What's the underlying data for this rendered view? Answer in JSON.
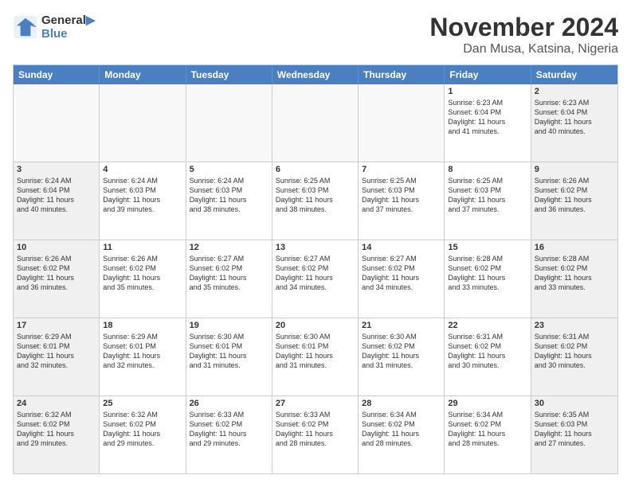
{
  "header": {
    "logo_line1": "General",
    "logo_line2": "Blue",
    "month_title": "November 2024",
    "location": "Dan Musa, Katsina, Nigeria"
  },
  "days_of_week": [
    "Sunday",
    "Monday",
    "Tuesday",
    "Wednesday",
    "Thursday",
    "Friday",
    "Saturday"
  ],
  "weeks": [
    [
      {
        "day": "",
        "info": ""
      },
      {
        "day": "",
        "info": ""
      },
      {
        "day": "",
        "info": ""
      },
      {
        "day": "",
        "info": ""
      },
      {
        "day": "",
        "info": ""
      },
      {
        "day": "1",
        "info": "Sunrise: 6:23 AM\nSunset: 6:04 PM\nDaylight: 11 hours\nand 41 minutes."
      },
      {
        "day": "2",
        "info": "Sunrise: 6:23 AM\nSunset: 6:04 PM\nDaylight: 11 hours\nand 40 minutes."
      }
    ],
    [
      {
        "day": "3",
        "info": "Sunrise: 6:24 AM\nSunset: 6:04 PM\nDaylight: 11 hours\nand 40 minutes."
      },
      {
        "day": "4",
        "info": "Sunrise: 6:24 AM\nSunset: 6:03 PM\nDaylight: 11 hours\nand 39 minutes."
      },
      {
        "day": "5",
        "info": "Sunrise: 6:24 AM\nSunset: 6:03 PM\nDaylight: 11 hours\nand 38 minutes."
      },
      {
        "day": "6",
        "info": "Sunrise: 6:25 AM\nSunset: 6:03 PM\nDaylight: 11 hours\nand 38 minutes."
      },
      {
        "day": "7",
        "info": "Sunrise: 6:25 AM\nSunset: 6:03 PM\nDaylight: 11 hours\nand 37 minutes."
      },
      {
        "day": "8",
        "info": "Sunrise: 6:25 AM\nSunset: 6:03 PM\nDaylight: 11 hours\nand 37 minutes."
      },
      {
        "day": "9",
        "info": "Sunrise: 6:26 AM\nSunset: 6:02 PM\nDaylight: 11 hours\nand 36 minutes."
      }
    ],
    [
      {
        "day": "10",
        "info": "Sunrise: 6:26 AM\nSunset: 6:02 PM\nDaylight: 11 hours\nand 36 minutes."
      },
      {
        "day": "11",
        "info": "Sunrise: 6:26 AM\nSunset: 6:02 PM\nDaylight: 11 hours\nand 35 minutes."
      },
      {
        "day": "12",
        "info": "Sunrise: 6:27 AM\nSunset: 6:02 PM\nDaylight: 11 hours\nand 35 minutes."
      },
      {
        "day": "13",
        "info": "Sunrise: 6:27 AM\nSunset: 6:02 PM\nDaylight: 11 hours\nand 34 minutes."
      },
      {
        "day": "14",
        "info": "Sunrise: 6:27 AM\nSunset: 6:02 PM\nDaylight: 11 hours\nand 34 minutes."
      },
      {
        "day": "15",
        "info": "Sunrise: 6:28 AM\nSunset: 6:02 PM\nDaylight: 11 hours\nand 33 minutes."
      },
      {
        "day": "16",
        "info": "Sunrise: 6:28 AM\nSunset: 6:02 PM\nDaylight: 11 hours\nand 33 minutes."
      }
    ],
    [
      {
        "day": "17",
        "info": "Sunrise: 6:29 AM\nSunset: 6:01 PM\nDaylight: 11 hours\nand 32 minutes."
      },
      {
        "day": "18",
        "info": "Sunrise: 6:29 AM\nSunset: 6:01 PM\nDaylight: 11 hours\nand 32 minutes."
      },
      {
        "day": "19",
        "info": "Sunrise: 6:30 AM\nSunset: 6:01 PM\nDaylight: 11 hours\nand 31 minutes."
      },
      {
        "day": "20",
        "info": "Sunrise: 6:30 AM\nSunset: 6:01 PM\nDaylight: 11 hours\nand 31 minutes."
      },
      {
        "day": "21",
        "info": "Sunrise: 6:30 AM\nSunset: 6:02 PM\nDaylight: 11 hours\nand 31 minutes."
      },
      {
        "day": "22",
        "info": "Sunrise: 6:31 AM\nSunset: 6:02 PM\nDaylight: 11 hours\nand 30 minutes."
      },
      {
        "day": "23",
        "info": "Sunrise: 6:31 AM\nSunset: 6:02 PM\nDaylight: 11 hours\nand 30 minutes."
      }
    ],
    [
      {
        "day": "24",
        "info": "Sunrise: 6:32 AM\nSunset: 6:02 PM\nDaylight: 11 hours\nand 29 minutes."
      },
      {
        "day": "25",
        "info": "Sunrise: 6:32 AM\nSunset: 6:02 PM\nDaylight: 11 hours\nand 29 minutes."
      },
      {
        "day": "26",
        "info": "Sunrise: 6:33 AM\nSunset: 6:02 PM\nDaylight: 11 hours\nand 29 minutes."
      },
      {
        "day": "27",
        "info": "Sunrise: 6:33 AM\nSunset: 6:02 PM\nDaylight: 11 hours\nand 28 minutes."
      },
      {
        "day": "28",
        "info": "Sunrise: 6:34 AM\nSunset: 6:02 PM\nDaylight: 11 hours\nand 28 minutes."
      },
      {
        "day": "29",
        "info": "Sunrise: 6:34 AM\nSunset: 6:02 PM\nDaylight: 11 hours\nand 28 minutes."
      },
      {
        "day": "30",
        "info": "Sunrise: 6:35 AM\nSunset: 6:03 PM\nDaylight: 11 hours\nand 27 minutes."
      }
    ]
  ]
}
